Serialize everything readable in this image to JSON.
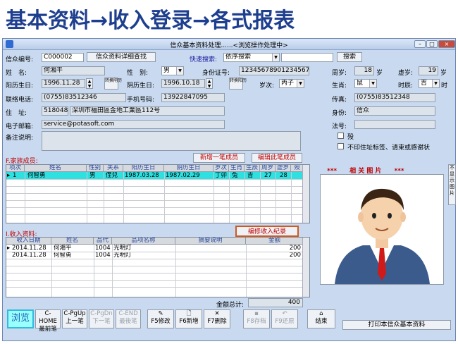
{
  "headline": "基本资料→收入登录→各式报表",
  "window": {
    "title": "信众基本资料处理......<浏览操作处理中>",
    "min": "–",
    "max": "□",
    "close": "×"
  },
  "form": {
    "id_label": "信众编号:",
    "id_value": "C000002",
    "lookup_btn": "信众资料详细查找",
    "quick_label": "快速搜索:",
    "quick_value": "依序搜索",
    "search_btn": "搜索",
    "name_label": "姓　名:",
    "name_value": "何湘平",
    "gender_label": "性　别:",
    "gender_value": "男",
    "idno_label": "身份证号:",
    "idno_value": "123456789012345678",
    "age_label": "周岁:",
    "age_value": "18",
    "age_unit": "岁",
    "vage_label": "虚岁:",
    "vage_value": "19",
    "vage_unit": "岁",
    "solar_label": "阳历生日:",
    "solar_value": "1996.11.28",
    "conv1": "转换阴历",
    "lunar_label": "阴历生日:",
    "lunar_value": "1996.10.18",
    "conv2": "转换阳历",
    "suici_label": "岁次:",
    "suici_value": "丙子",
    "zodiac_label": "生肖:",
    "zodiac_value": "鼠",
    "hour_label": "时辰:",
    "hour_value": "吉",
    "hour_unit": "时",
    "phone_label": "联络电话:",
    "phone_value": "(0755)83512346",
    "mobile_label": "手机号码:",
    "mobile_value": "13922847095",
    "fax_label": "传真:",
    "fax_value": "(0755)83512348",
    "addr_label": "住　址:",
    "zip_value": "518048",
    "addr_value": "深圳市福田區金地工業區112号",
    "status_label": "身份:",
    "status_value": "信众",
    "email_label": "电子邮箱:",
    "email_value": "service@potasoft.com",
    "dharma_label": "法号:",
    "dharma_value": "",
    "note_label": "备注说明:",
    "note_value": "",
    "chk1": "殁",
    "chk2": "不印住址标签、请束或感谢状"
  },
  "family": {
    "title": "F.家族成员:",
    "add_btn": "新增一笔成员",
    "edit_btn": "编辑此笔成员",
    "headers": [
      "项次",
      "姓名",
      "性别",
      "关系",
      "阳历生日",
      "阴历生日",
      "岁次",
      "生肖",
      "生辰",
      "周岁",
      "虚岁",
      "殁"
    ],
    "rows": [
      {
        "no": "1",
        "name": "何智勇",
        "sex": "男",
        "rel": "侄兒",
        "solar": "1987.03.28",
        "lunar": "1987.02.29",
        "suici": "丁卯",
        "zodiac": "兔",
        "hour": "吉",
        "age": "27",
        "vage": "28",
        "dead": ""
      }
    ]
  },
  "photo": {
    "title": "***　　相 关 图 片　　***",
    "hide_btn": "不显示图片"
  },
  "income": {
    "title": "I.收入资料:",
    "edit_btn": "编修收入纪录",
    "headers": [
      "收入日期",
      "姓名",
      "品代",
      "品项名称",
      "摘要说明",
      "金额"
    ],
    "rows": [
      {
        "date": "2014.11.28",
        "name": "何湘平",
        "code": "1004",
        "item": "光明灯",
        "memo": "",
        "amount": "200"
      },
      {
        "date": "2014.11.28",
        "name": "何智勇",
        "code": "1004",
        "item": "光明灯",
        "memo": "",
        "amount": "200"
      }
    ],
    "total_label": "金额总计:",
    "total_value": "400"
  },
  "toolbar": {
    "browse": "浏览",
    "first_top": "C-HOME",
    "first_bot": "最前笔",
    "prev_top": "C-PgUp",
    "prev_bot": "上一笔",
    "next_top": "C-PgDn",
    "next_bot": "下一笔",
    "last_top": "C-END",
    "last_bot": "最後笔",
    "f5": "F5修改",
    "f6": "F6新增",
    "f7": "F7删除",
    "f8": "F8存档",
    "f9": "F9还原",
    "end": "结束",
    "print": "打印本信众基本资料"
  }
}
